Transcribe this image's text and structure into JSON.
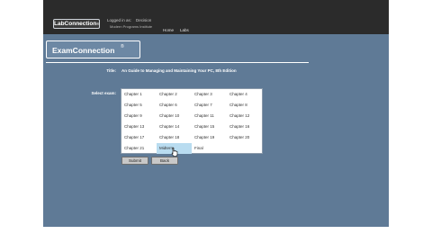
{
  "header": {
    "logo_text": "LabConnection",
    "logo_mark": "®",
    "info_left_1": "Logged in as:",
    "info_left_2": "",
    "info_right_1": "Decision",
    "subtitle": "Modern Programs Institute",
    "nav": [
      "Home",
      "Labs"
    ]
  },
  "brand": {
    "text": "ExamConnection",
    "mark": "®"
  },
  "form": {
    "title_label": "Title:",
    "title_value": "An Guide to Managing and Maintaining Your PC, 8th Edition",
    "select_label": "Select exam:",
    "exams": [
      [
        "Chapter 1",
        "Chapter 2",
        "Chapter 3",
        "Chapter 4"
      ],
      [
        "Chapter 5",
        "Chapter 6",
        "Chapter 7",
        "Chapter 8"
      ],
      [
        "Chapter 9",
        "Chapter 10",
        "Chapter 11",
        "Chapter 12"
      ],
      [
        "Chapter 13",
        "Chapter 14",
        "Chapter 15",
        "Chapter 16"
      ],
      [
        "Chapter 17",
        "Chapter 18",
        "Chapter 19",
        "Chapter 20"
      ],
      [
        "Chapter 21",
        "Midterm",
        "Final",
        ""
      ]
    ],
    "highlighted": "Midterm",
    "submit_label": "Submit",
    "back_label": "Back"
  },
  "colors": {
    "frame_bg": "#5f7a96",
    "topbar_bg": "#2b2b2b",
    "highlight": "#b9dcf0"
  },
  "icons": {
    "cursor": "pointer-hand-icon"
  }
}
